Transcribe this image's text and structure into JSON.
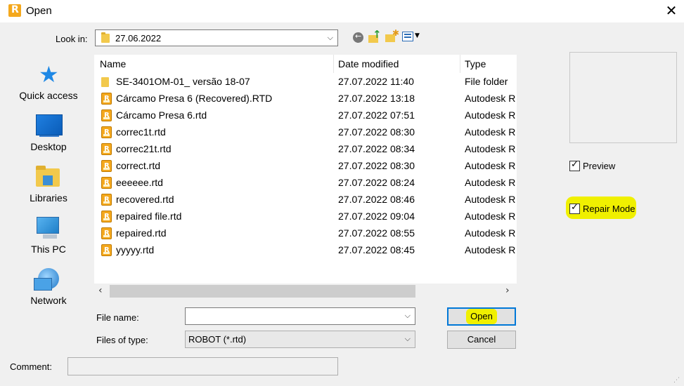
{
  "window": {
    "title": "Open",
    "app_icon_letter": "R",
    "close_glyph": "✕"
  },
  "look_in": {
    "label": "Look in:",
    "value": "27.06.2022"
  },
  "toolbar": {
    "icons": [
      "back-icon",
      "up-folder-icon",
      "new-folder-icon",
      "view-menu-icon"
    ]
  },
  "places": [
    {
      "label": "Quick access",
      "icon": "quick-access-icon"
    },
    {
      "label": "Desktop",
      "icon": "desktop-icon"
    },
    {
      "label": "Libraries",
      "icon": "libraries-icon"
    },
    {
      "label": "This PC",
      "icon": "this-pc-icon"
    },
    {
      "label": "Network",
      "icon": "network-icon"
    }
  ],
  "file_list": {
    "columns": [
      "Name",
      "Date modified",
      "Type"
    ],
    "rows": [
      {
        "name": "SE-3401OM-01_ versão 18-07",
        "date": "27.07.2022 11:40",
        "type": "File folder",
        "kind": "folder"
      },
      {
        "name": "Cárcamo Presa 6 (Recovered).RTD",
        "date": "27.07.2022 13:18",
        "type": "Autodesk R",
        "kind": "rtd"
      },
      {
        "name": "Cárcamo Presa 6.rtd",
        "date": "27.07.2022 07:51",
        "type": "Autodesk R",
        "kind": "rtd"
      },
      {
        "name": "correc1t.rtd",
        "date": "27.07.2022 08:30",
        "type": "Autodesk R",
        "kind": "rtd"
      },
      {
        "name": "correc21t.rtd",
        "date": "27.07.2022 08:34",
        "type": "Autodesk R",
        "kind": "rtd"
      },
      {
        "name": "correct.rtd",
        "date": "27.07.2022 08:30",
        "type": "Autodesk R",
        "kind": "rtd"
      },
      {
        "name": "eeeeee.rtd",
        "date": "27.07.2022 08:24",
        "type": "Autodesk R",
        "kind": "rtd"
      },
      {
        "name": "recovered.rtd",
        "date": "27.07.2022 08:46",
        "type": "Autodesk R",
        "kind": "rtd"
      },
      {
        "name": "repaired file.rtd",
        "date": "27.07.2022 09:04",
        "type": "Autodesk R",
        "kind": "rtd"
      },
      {
        "name": "repaired.rtd",
        "date": "27.07.2022 08:55",
        "type": "Autodesk R",
        "kind": "rtd"
      },
      {
        "name": "yyyyy.rtd",
        "date": "27.07.2022 08:45",
        "type": "Autodesk R",
        "kind": "rtd"
      }
    ]
  },
  "file_name": {
    "label": "File name:",
    "value": ""
  },
  "file_type": {
    "label": "Files of type:",
    "value": "ROBOT (*.rtd)"
  },
  "buttons": {
    "open": "Open",
    "cancel": "Cancel"
  },
  "options": {
    "preview": {
      "label": "Preview",
      "checked": true
    },
    "repair_mode": {
      "label": "Repair Mode",
      "checked": true
    }
  },
  "comment": {
    "label": "Comment:",
    "value": ""
  },
  "colors": {
    "highlight": "#f0f000",
    "accent": "#0078d7",
    "rtd_icon": "#f4a81d",
    "folder": "#f2c94c"
  }
}
